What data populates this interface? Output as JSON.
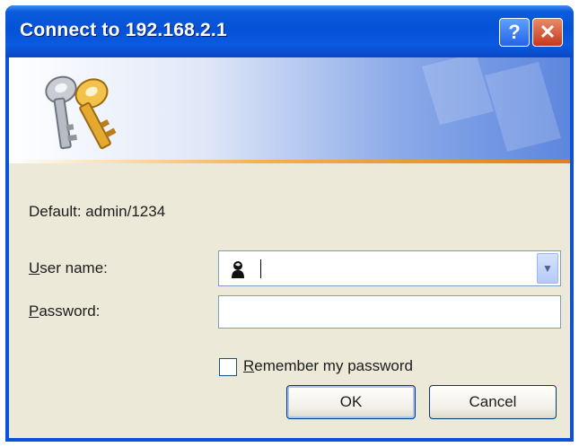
{
  "window": {
    "title": "Connect to 192.168.2.1",
    "help_glyph": "?",
    "close_glyph": "✕",
    "colors": {
      "titlebar": "#0552d6",
      "client": "#ece9d8",
      "accent_stripe": "#e47d1d"
    }
  },
  "banner": {
    "icon": "keys-icon"
  },
  "form": {
    "default_hint": "Default: admin/1234",
    "username": {
      "label_accel": "U",
      "label_rest": "ser name:",
      "value": "",
      "icon": "user-icon"
    },
    "password": {
      "label_accel": "P",
      "label_rest": "assword:",
      "value": ""
    },
    "remember": {
      "label_accel": "R",
      "label_rest": "emember my password",
      "checked": false
    }
  },
  "buttons": {
    "ok": "OK",
    "cancel": "Cancel"
  }
}
